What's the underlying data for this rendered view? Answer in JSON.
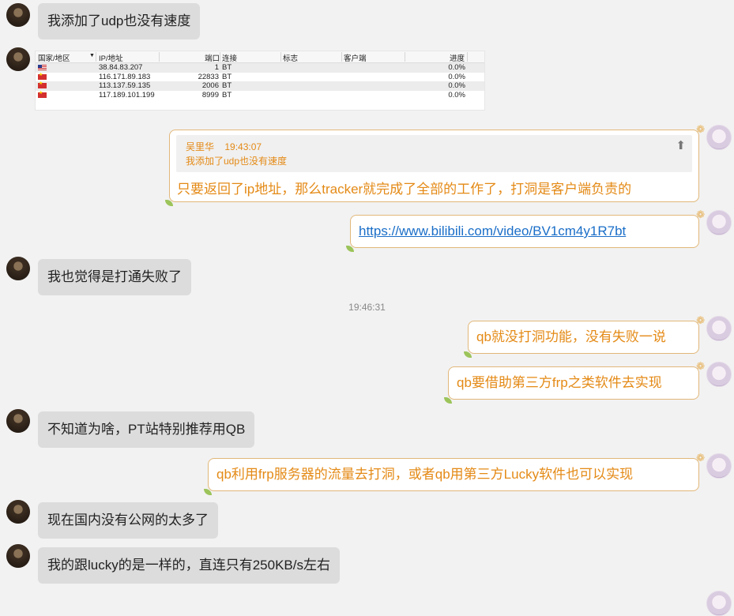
{
  "messages": {
    "m1": "我添加了udp也没有速度",
    "m3_quote_sender": "吴里华",
    "m3_quote_time": "19:43:07",
    "m3_quote_text": "我添加了udp也没有速度",
    "m3": "只要返回了ip地址，那么tracker就完成了全部的工作了，打洞是客户端负责的",
    "m4_link": "https://www.bilibili.com/video/BV1cm4y1R7bt",
    "m5": "我也觉得是打通失败了",
    "timestamp": "19:46:31",
    "m6": "qb就没打洞功能，没有失败一说",
    "m7": "qb要借助第三方frp之类软件去实现",
    "m8": "不知道为啥，PT站特别推荐用QB",
    "m9": "qb利用frp服务器的流量去打洞，或者qb用第三方Lucky软件也可以实现",
    "m10": "现在国内没有公网的太多了",
    "m11": "我的跟lucky的是一样的，直连只有250KB/s左右"
  },
  "peers_table": {
    "headers": {
      "country": "国家/地区",
      "sort_indicator": "▼",
      "ip": "IP/地址",
      "port": "端口",
      "connection": "连接",
      "flags": "标志",
      "client": "客户端",
      "progress": "进度"
    },
    "rows": [
      {
        "flag": "us-flag",
        "ip": "38.84.83.207",
        "port": "1",
        "connection": "BT",
        "progress": "0.0%"
      },
      {
        "flag": "cn-flag",
        "ip": "116.171.89.183",
        "port": "22833",
        "connection": "BT",
        "progress": "0.0%"
      },
      {
        "flag": "cn-flag",
        "ip": "113.137.59.135",
        "port": "2006",
        "connection": "BT",
        "progress": "0.0%"
      },
      {
        "flag": "cn-flag",
        "ip": "117.189.101.199",
        "port": "8999",
        "connection": "BT",
        "progress": "0.0%"
      }
    ]
  },
  "colors": {
    "self_text": "#e48a16",
    "self_border": "#e2b87a",
    "other_bubble": "#dcdcdc",
    "link": "#1a6ec8",
    "background": "#f2f2f2"
  }
}
